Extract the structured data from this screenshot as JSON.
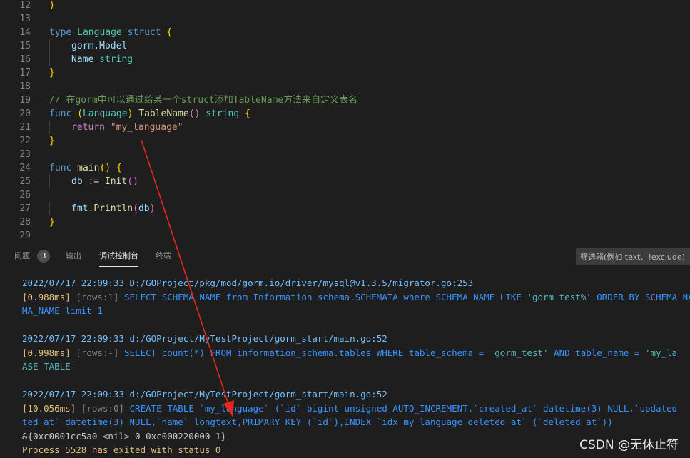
{
  "editor": {
    "lines": [
      {
        "n": "12",
        "tokens": [
          {
            "t": ")",
            "c": "br1"
          }
        ]
      },
      {
        "n": "13",
        "tokens": []
      },
      {
        "n": "14",
        "tokens": [
          {
            "t": "type ",
            "c": "kw"
          },
          {
            "t": "Language ",
            "c": "ty"
          },
          {
            "t": "struct ",
            "c": "kw"
          },
          {
            "t": "{",
            "c": "br1"
          }
        ]
      },
      {
        "n": "15",
        "indent": 1,
        "tokens": [
          {
            "t": "gorm.Model",
            "c": "vr"
          }
        ]
      },
      {
        "n": "16",
        "indent": 1,
        "tokens": [
          {
            "t": "Name ",
            "c": "vr"
          },
          {
            "t": "string",
            "c": "ty"
          }
        ]
      },
      {
        "n": "17",
        "tokens": [
          {
            "t": "}",
            "c": "br1"
          }
        ]
      },
      {
        "n": "18",
        "tokens": []
      },
      {
        "n": "19",
        "tokens": [
          {
            "t": "// 在gorm中可以通过给某一个struct添加TableName方法来自定义表名",
            "c": "cm"
          }
        ]
      },
      {
        "n": "20",
        "tokens": [
          {
            "t": "func ",
            "c": "kw"
          },
          {
            "t": "(",
            "c": "br1"
          },
          {
            "t": "Language",
            "c": "ty"
          },
          {
            "t": ") ",
            "c": "br1"
          },
          {
            "t": "TableName",
            "c": "fn"
          },
          {
            "t": "() ",
            "c": "br2"
          },
          {
            "t": "string ",
            "c": "ty"
          },
          {
            "t": "{",
            "c": "br1"
          }
        ]
      },
      {
        "n": "21",
        "indent": 1,
        "tokens": [
          {
            "t": "return ",
            "c": "ct"
          },
          {
            "t": "\"my_language\"",
            "c": "st"
          }
        ]
      },
      {
        "n": "22",
        "tokens": [
          {
            "t": "}",
            "c": "br1"
          }
        ]
      },
      {
        "n": "23",
        "tokens": []
      },
      {
        "n": "24",
        "tokens": [
          {
            "t": "func ",
            "c": "kw"
          },
          {
            "t": "main",
            "c": "fn"
          },
          {
            "t": "() ",
            "c": "br1"
          },
          {
            "t": "{",
            "c": "br1"
          }
        ]
      },
      {
        "n": "25",
        "indent": 1,
        "tokens": [
          {
            "t": "db ",
            "c": "vr"
          },
          {
            "t": ":= ",
            "c": "pu"
          },
          {
            "t": "Init",
            "c": "fn"
          },
          {
            "t": "()",
            "c": "br2"
          }
        ]
      },
      {
        "n": "26",
        "tokens": []
      },
      {
        "n": "27",
        "indent": 1,
        "tokens": [
          {
            "t": "fmt",
            "c": "vr"
          },
          {
            "t": ".",
            "c": "pu"
          },
          {
            "t": "Println",
            "c": "fn"
          },
          {
            "t": "(",
            "c": "br2"
          },
          {
            "t": "db",
            "c": "vr"
          },
          {
            "t": ")",
            "c": "br2"
          }
        ]
      },
      {
        "n": "28",
        "tokens": [
          {
            "t": "}",
            "c": "br1"
          }
        ]
      },
      {
        "n": "29",
        "tokens": []
      }
    ]
  },
  "panel": {
    "tabs": [
      {
        "label": "问题",
        "active": false
      },
      {
        "label": "输出",
        "active": false
      },
      {
        "label": "调试控制台",
        "active": true
      },
      {
        "label": "终端",
        "active": false
      }
    ],
    "problems_count": "3",
    "filter_placeholder": "筛选器(例如 text、!exclude)"
  },
  "console": {
    "lines": [
      [
        {
          "t": "2022/07/17 22:09:33 ",
          "c": "ts"
        },
        {
          "t": "D:/GOProject/pkg/mod/gorm.io/driver/mysql@v1.3.5/migrator.go:253",
          "c": "path"
        }
      ],
      [
        {
          "t": "[0.988ms] ",
          "c": "tm"
        },
        {
          "t": "[rows:1] ",
          "c": "rows"
        },
        {
          "t": "SELECT SCHEMA_NAME from Information_schema.SCHEMATA where SCHEMA_NAME LIKE ",
          "c": "sql"
        },
        {
          "t": "'gorm_test%'",
          "c": "sqlstr"
        },
        {
          "t": " ORDER BY SCHEMA_NA",
          "c": "sql"
        }
      ],
      [
        {
          "t": "MA_NAME limit 1",
          "c": "sql"
        }
      ],
      [],
      [
        {
          "t": "2022/07/17 22:09:33 ",
          "c": "ts"
        },
        {
          "t": "d:/GOProject/MyTestProject/gorm_start/main.go:52",
          "c": "path"
        }
      ],
      [
        {
          "t": "[0.998ms] ",
          "c": "tm"
        },
        {
          "t": "[rows:-] ",
          "c": "rows"
        },
        {
          "t": "SELECT count(*) FROM information_schema.tables WHERE table_schema = ",
          "c": "sql"
        },
        {
          "t": "'gorm_test'",
          "c": "sqlstr"
        },
        {
          "t": " AND table_name = ",
          "c": "sql"
        },
        {
          "t": "'my_la",
          "c": "sqlstr"
        }
      ],
      [
        {
          "t": "ASE TABLE'",
          "c": "sqlstr"
        }
      ],
      [],
      [
        {
          "t": "2022/07/17 22:09:33 ",
          "c": "ts"
        },
        {
          "t": "d:/GOProject/MyTestProject/gorm_start/main.go:52",
          "c": "path"
        }
      ],
      [
        {
          "t": "[10.056ms] ",
          "c": "tm"
        },
        {
          "t": "[rows:0] ",
          "c": "rows"
        },
        {
          "t": "CREATE TABLE `my_language` (`id` bigint unsigned AUTO_INCREMENT,`created_at` datetime(3) NULL,`updated",
          "c": "sql"
        }
      ],
      [
        {
          "t": "ted_at` datetime(3) NULL,`name` longtext,PRIMARY KEY (`id`),INDEX `idx_my_language_deleted_at` (`deleted_at`))",
          "c": "sql"
        }
      ],
      [
        {
          "t": "&{0xc0001cc5a0 <nil> 0 0xc000220000 1}",
          "c": "plain"
        }
      ],
      [
        {
          "t": "Process 5528 has exited with status 0",
          "c": "warn"
        }
      ]
    ]
  },
  "colors": {
    "annotation_arrow": "#e5281e",
    "background": "#1e1e1e"
  },
  "watermark": "CSDN @无休止符"
}
